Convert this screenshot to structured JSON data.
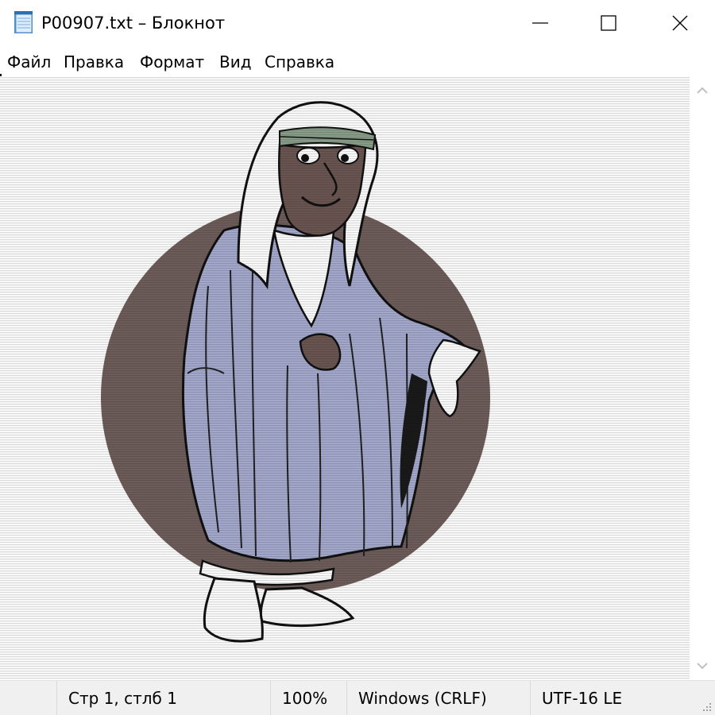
{
  "window": {
    "title": "P00907.txt – Блокнот",
    "icon": "notepad-icon",
    "controls": [
      "minimize-icon",
      "maximize-icon",
      "close-icon"
    ]
  },
  "menu": {
    "items": [
      {
        "label": "Файл"
      },
      {
        "label": "Правка"
      },
      {
        "label": "Формат"
      },
      {
        "label": "Вид"
      },
      {
        "label": "Справка"
      }
    ]
  },
  "status": {
    "position": "Стр 1, стлб 1",
    "zoom": "100%",
    "line_ending": "Windows (CRLF)",
    "encoding": "UTF-16 LE"
  },
  "colors": {
    "circle": "#6f5e5b",
    "robe": "#a6abcf",
    "skin": "#6b5652",
    "headband": "#8aa08a",
    "outline": "#111111"
  }
}
